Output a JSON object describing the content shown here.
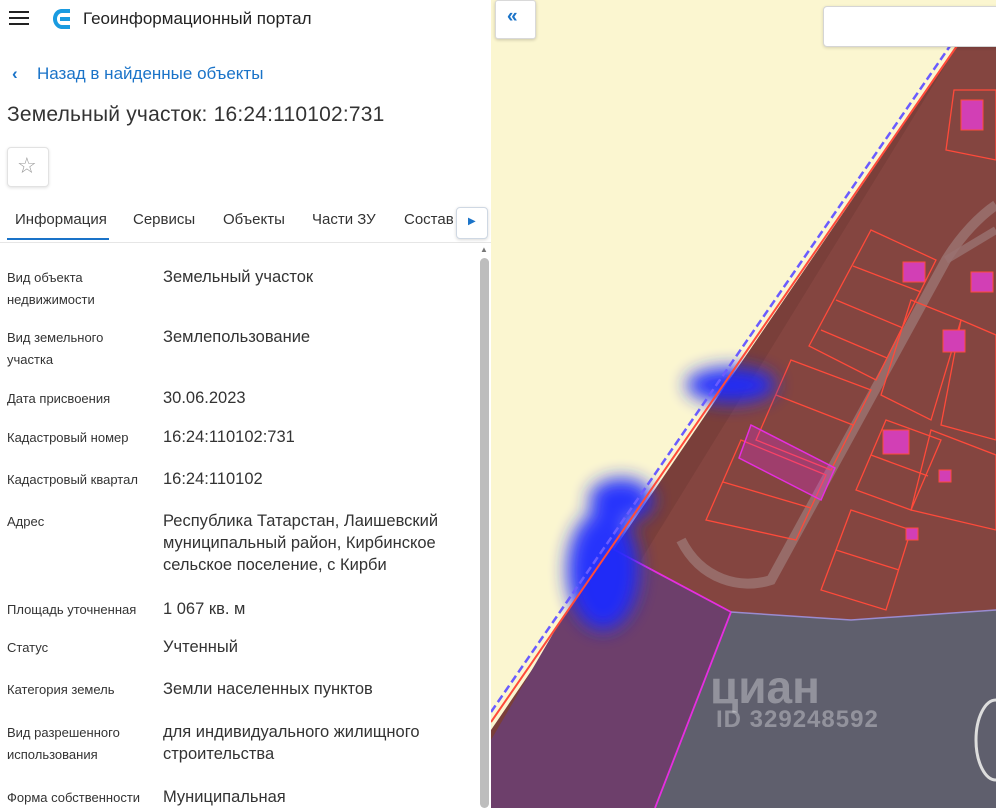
{
  "app": {
    "title": "Геоинформационный портал"
  },
  "nav": {
    "back_label": "Назад в найденные объекты"
  },
  "object": {
    "title": "Земельный участок: 16:24:110102:731"
  },
  "icons": {
    "menu": "hamburger-icon",
    "logo": "portal-logo-icon",
    "back": "chevron-left-icon",
    "favorite": "star-outline-icon",
    "tabs_next": "triangle-right-icon",
    "collapse": "double-chevron-left-icon"
  },
  "tabs": [
    {
      "label": "Информация"
    },
    {
      "label": "Сервисы"
    },
    {
      "label": "Объекты"
    },
    {
      "label": "Части ЗУ"
    },
    {
      "label": "Состав"
    }
  ],
  "properties": [
    {
      "label": "Вид объекта недвижимости",
      "value": "Земельный участок"
    },
    {
      "label": "Вид земельного участка",
      "value": "Землепользование"
    },
    {
      "label": "Дата присвоения",
      "value": "30.06.2023"
    },
    {
      "label": "Кадастровый номер",
      "value": "16:24:110102:731"
    },
    {
      "label": "Кадастровый квартал",
      "value": "16:24:110102"
    },
    {
      "label": "Адрес",
      "value": "Республика Татарстан, Лаишевский муниципальный район, Кирбинское сельское поселение, с Кирби"
    },
    {
      "label": "Площадь уточненная",
      "value": "1 067 кв. м"
    },
    {
      "label": "Статус",
      "value": "Учтенный"
    },
    {
      "label": "Категория земель",
      "value": "Земли населенных пунктов"
    },
    {
      "label": "Вид разрешенного использования",
      "value": "для индивидуального жилищного строительства"
    },
    {
      "label": "Форма собственности",
      "value": "Муниципальная"
    }
  ],
  "map": {
    "search_value": "",
    "watermark": "циан",
    "watermark_id": "ID 329248592"
  },
  "colors": {
    "accent": "#1a73c8",
    "parcel_outline": "#ff3b3b",
    "selected_parcel": "#e62ee0",
    "sand": "#fbf6d0"
  }
}
